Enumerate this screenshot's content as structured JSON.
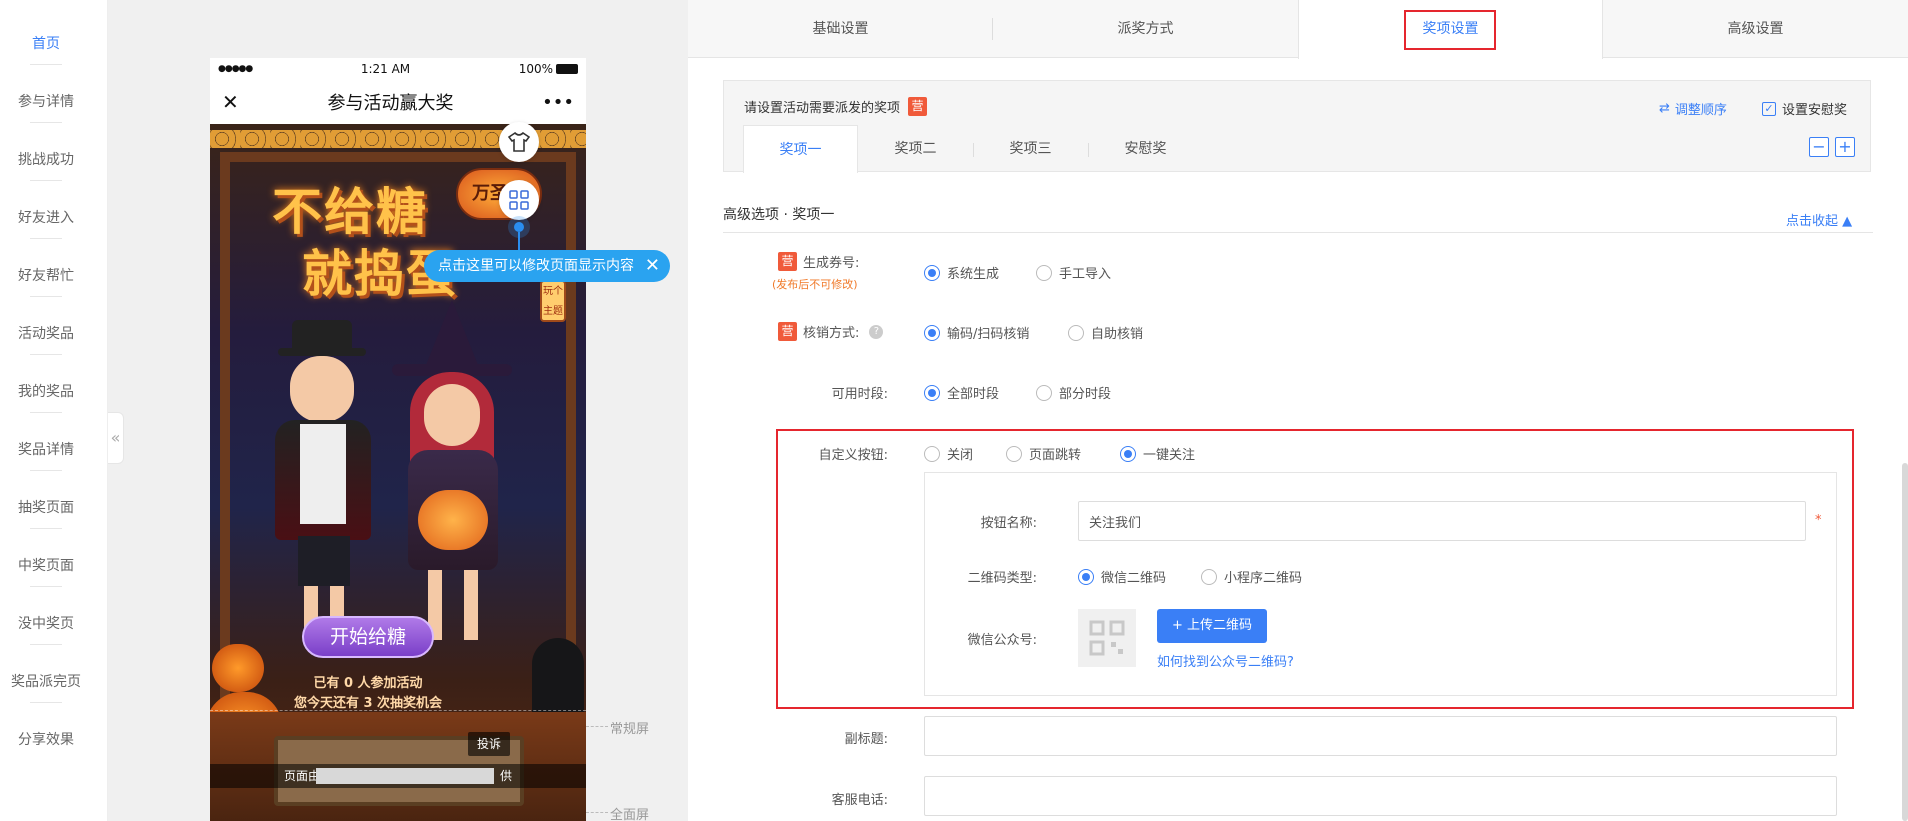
{
  "nav": {
    "items": [
      "首页",
      "参与详情",
      "挑战成功",
      "好友进入",
      "好友帮忙",
      "活动奖品",
      "我的奖品",
      "奖品详情",
      "抽奖页面",
      "中奖页面",
      "没中奖页",
      "奖品派完页",
      "分享效果"
    ],
    "collapse_icon": "«"
  },
  "phone": {
    "signal": "●●●●●",
    "time": "1:21 AM",
    "battery": "100%",
    "title": "参与活动赢大奖",
    "more": "•••",
    "close": "✕",
    "poster": {
      "headline_1": "不给糖",
      "headline_2": "就捣蛋",
      "badge": "万圣节",
      "lantern_text": "玩个主题",
      "start_button": "开始给糖",
      "count_text": "已有 0 人参加活动",
      "chances_text": "您今天还有 3 次抽奖机会",
      "report": "投诉",
      "footer_left": "页面由",
      "footer_right": "供"
    }
  },
  "tip": {
    "text": "点击这里可以修改页面显示内容",
    "close": "✕"
  },
  "screen_labels": {
    "normal": "常规屏",
    "full": "全面屏"
  },
  "top_tabs": [
    "基础设置",
    "派奖方式",
    "奖项设置",
    "高级设置"
  ],
  "active_top_tab": "奖项设置",
  "prize_panel": {
    "title": "请设置活动需要派发的奖项",
    "tag": "营",
    "reorder": "调整顺序",
    "consolation_checkbox": "设置安慰奖",
    "tabs": [
      "奖项一",
      "奖项二",
      "奖项三",
      "安慰奖"
    ],
    "minus": "−",
    "plus": "+"
  },
  "advanced": {
    "title": "高级选项 · 奖项一",
    "collapse_link": "点击收起 ▲"
  },
  "form": {
    "coupon_label": "生成券号:",
    "coupon_note": "(发布后不可修改)",
    "coupon_options": [
      "系统生成",
      "手工导入"
    ],
    "verify_label": "核销方式:",
    "verify_options": [
      "输码/扫码核销",
      "自助核销"
    ],
    "time_label": "可用时段:",
    "time_options": [
      "全部时段",
      "部分时段"
    ],
    "custom_btn_label": "自定义按钮:",
    "custom_btn_options": [
      "关闭",
      "页面跳转",
      "一键关注"
    ],
    "btn_name_label": "按钮名称:",
    "btn_name_value": "关注我们",
    "required_star": "*",
    "qr_type_label": "二维码类型:",
    "qr_type_options": [
      "微信二维码",
      "小程序二维码"
    ],
    "wechat_label": "微信公众号:",
    "upload_button": "+ 上传二维码",
    "find_qr_link": "如何找到公众号二维码?",
    "subtitle_label": "副标题:",
    "phone_label": "客服电话:"
  },
  "colors": {
    "accent": "#3a7ff6",
    "highlight": "#e5262e",
    "tag": "#f05a3a"
  }
}
